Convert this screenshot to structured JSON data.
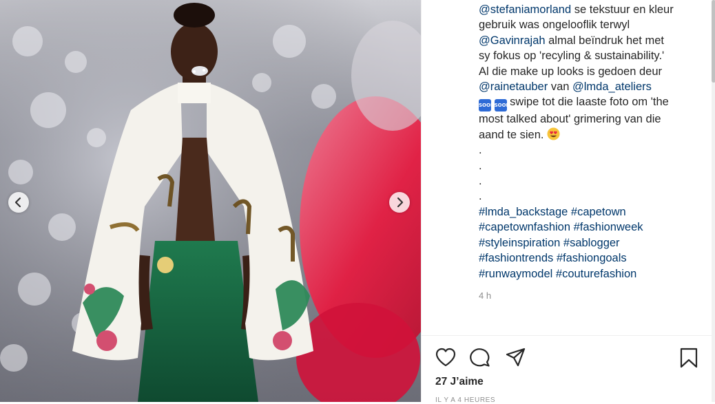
{
  "post": {
    "image_alt": "Runway model in white embroidered cape",
    "carousel": {
      "prev_icon": "chevron-left-icon",
      "next_icon": "chevron-right-icon"
    }
  },
  "caption": {
    "mention_1": "@stefaniamorland",
    "text_1": " se tekstuur en kleur",
    "text_2": "gebruik was ongelooflik terwyl",
    "mention_2": "@Gavinrajah",
    "text_3": " almal beïndruk het met",
    "text_4": "sy fokus op 'recyling & sustainability.'",
    "text_5": "Al die make up looks is gedoen deur",
    "mention_3": "@rainetauber",
    "text_6": " van ",
    "mention_4": "@lmda_ateliers",
    "soon_icon": "soon-arrow-icon",
    "soon_label": "SOON",
    "text_7": " swipe tot die laaste foto om 'the",
    "text_8": "most talked about' grimering van die",
    "text_9": "aand te sien. ",
    "emoji": "heart-eyes-emoji-icon",
    "dot": ".",
    "hashtags_1": "#lmda_backstage #capetown",
    "hashtags_2": "#capetownfashion #fashionweek",
    "hashtags_3": "#styleinspiration #sablogger",
    "hashtags_4": "#fashiontrends #fashiongoals",
    "hashtags_5": "#runwaymodel #couturefashion"
  },
  "timestamp": "4 h",
  "actions": {
    "like_icon": "heart-icon",
    "comment_icon": "comment-icon",
    "share_icon": "paper-plane-icon",
    "save_icon": "bookmark-icon"
  },
  "likes": "27 J’aime",
  "posted": "IL Y A 4 HEURES"
}
